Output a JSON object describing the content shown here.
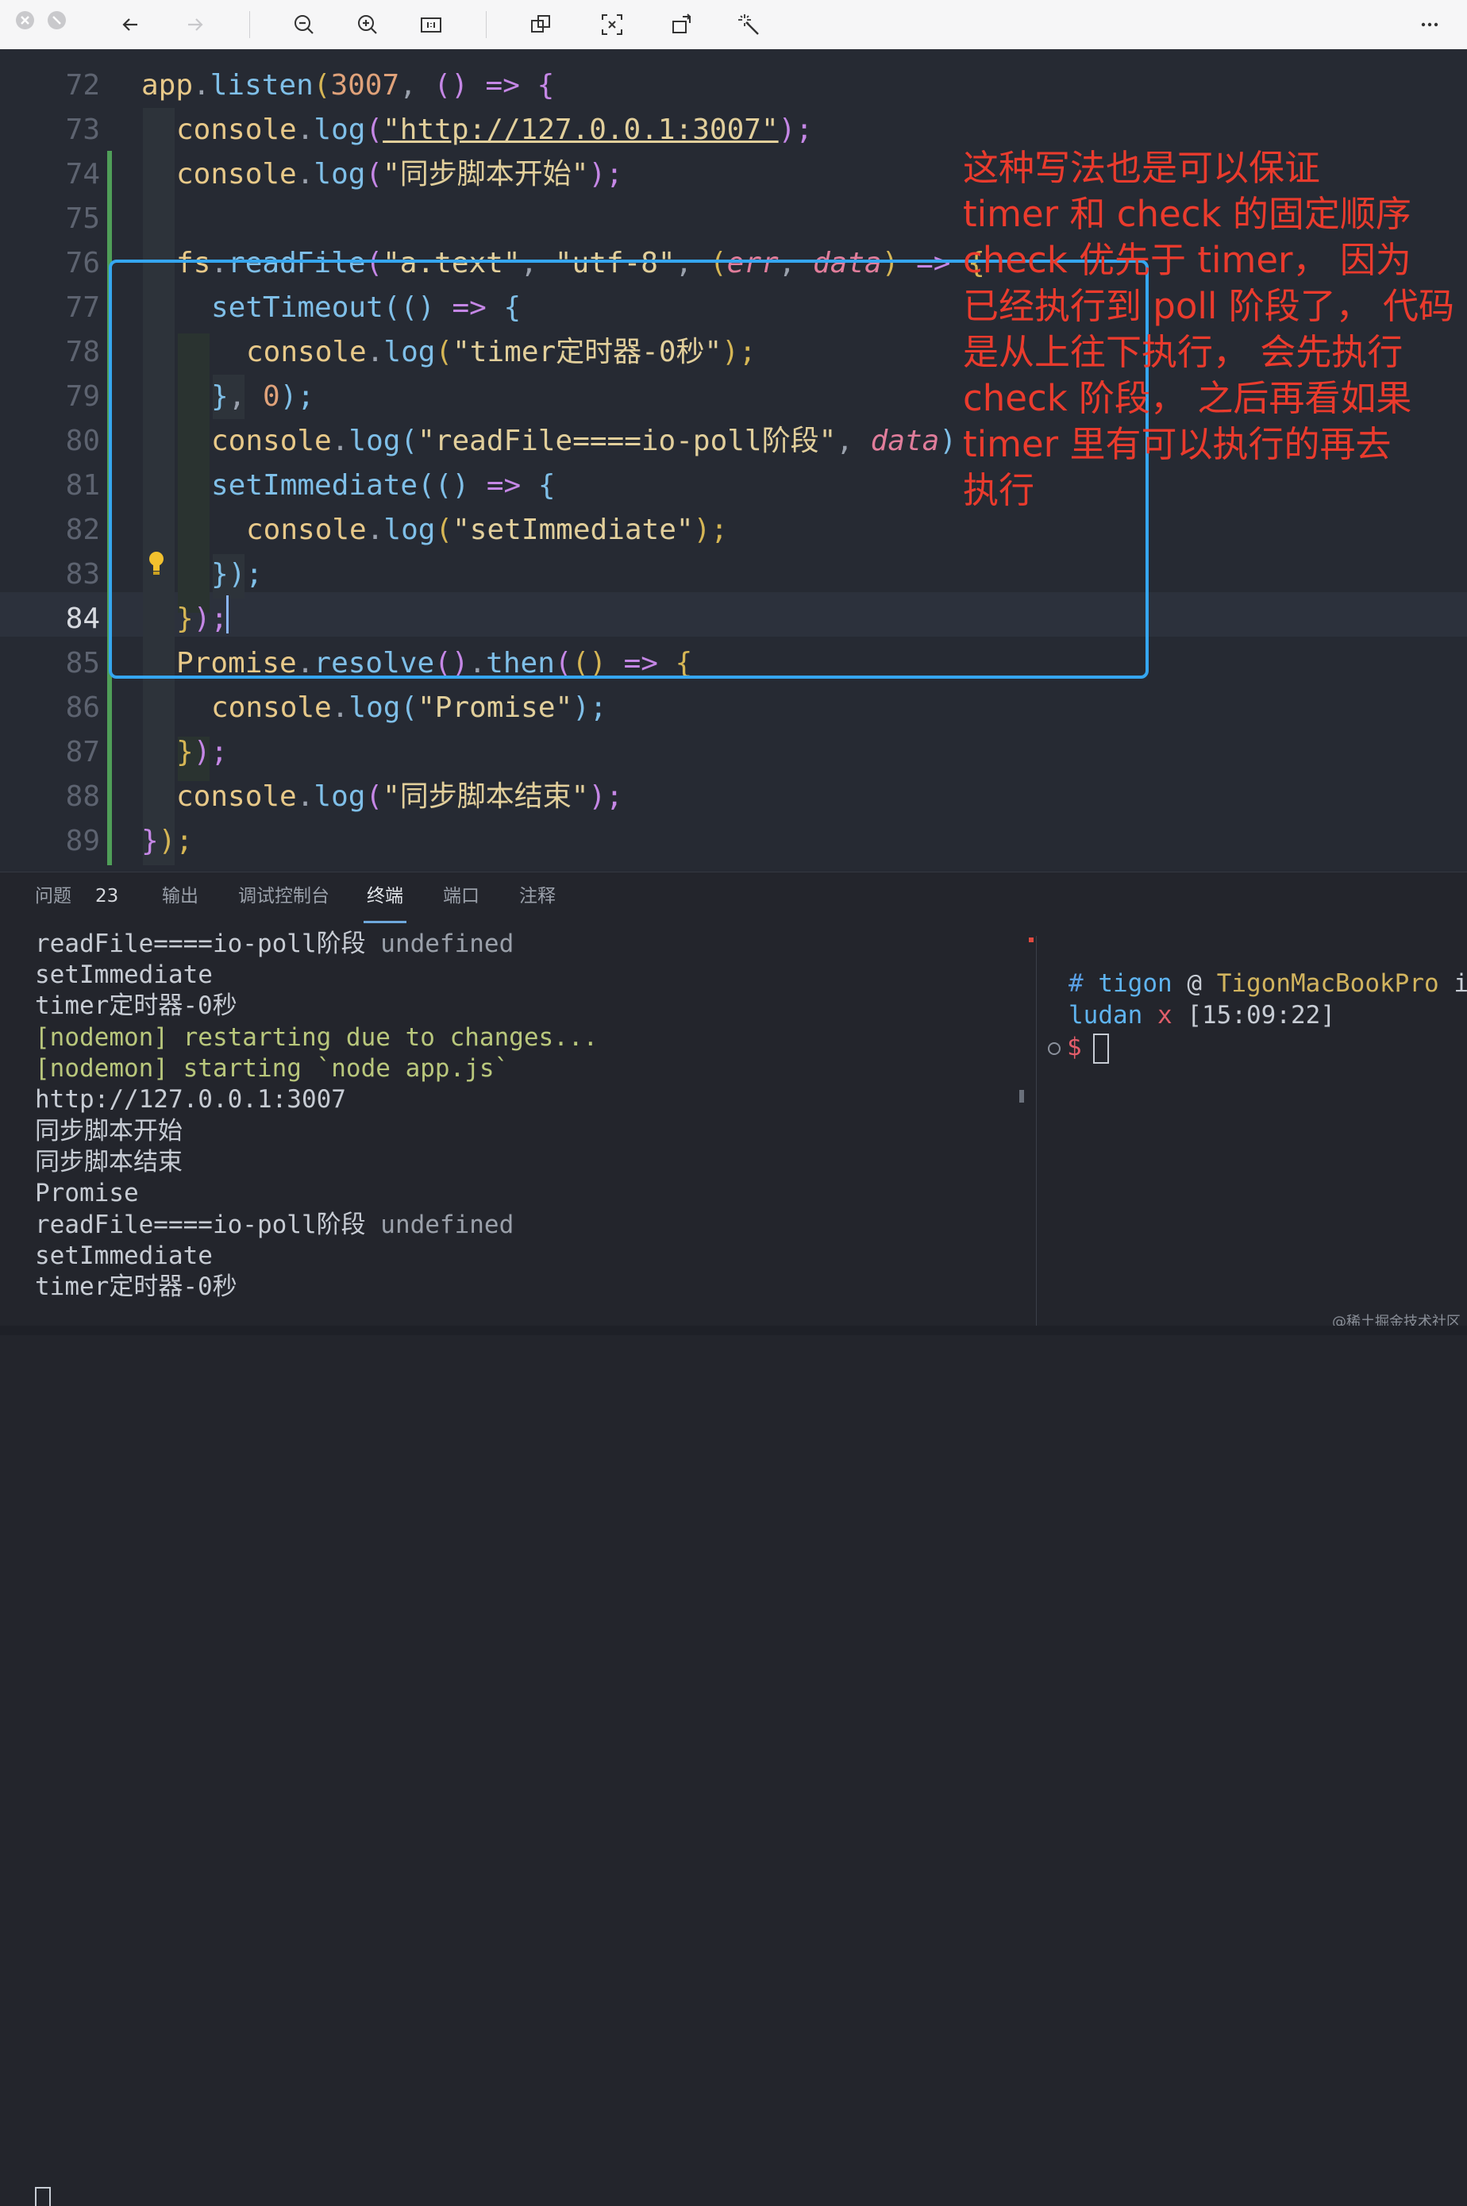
{
  "toolbar": {
    "buttons": [
      "close-icon",
      "minimize-icon",
      "back-icon",
      "forward-icon",
      "zoom-out-icon",
      "zoom-in-icon",
      "actual-size-icon",
      "translate-icon",
      "scan-text-icon",
      "rotate-icon",
      "magic-wand-icon",
      "more-icon"
    ]
  },
  "editor": {
    "line_numbers": [
      "72",
      "73",
      "74",
      "75",
      "76",
      "77",
      "78",
      "79",
      "80",
      "81",
      "82",
      "83",
      "84",
      "85",
      "86",
      "87",
      "88",
      "89"
    ],
    "active_line": "84",
    "code": {
      "l72": {
        "a": "app",
        "b": ".",
        "c": "listen",
        "d": "(",
        "e": "3007",
        "f": ", ",
        "g": "()",
        "h": " => ",
        "i": "{"
      },
      "l73": {
        "a": "console",
        "b": ".",
        "c": "log",
        "d": "(",
        "e": "\"http://127.0.0.1:3007\"",
        "f": ");"
      },
      "l74": {
        "a": "console",
        "b": ".",
        "c": "log",
        "d": "(",
        "e": "\"同步脚本开始\"",
        "f": ");"
      },
      "l76": {
        "a": "fs",
        "b": ".",
        "c": "readFile",
        "d": "(",
        "e": "\"a.text\"",
        "f": ", ",
        "g": "\"utf-8\"",
        "h": ", ",
        "i": "(",
        "j": "err",
        "k": ", ",
        "l": "data",
        "m": ")",
        "n": " => ",
        "o": "{"
      },
      "l77": {
        "a": "setTimeout",
        "b": "(",
        "c": "()",
        "d": " => ",
        "e": "{"
      },
      "l78": {
        "a": "console",
        "b": ".",
        "c": "log",
        "d": "(",
        "e": "\"timer定时器-0秒\"",
        "f": ");"
      },
      "l79": {
        "a": "}",
        "b": ", ",
        "c": "0",
        "d": ");"
      },
      "l80": {
        "a": "console",
        "b": ".",
        "c": "log",
        "d": "(",
        "e": "\"readFile====io-poll阶段\"",
        "f": ", ",
        "g": "data",
        "h": ")"
      },
      "l81": {
        "a": "setImmediate",
        "b": "(",
        "c": "()",
        "d": " => ",
        "e": "{"
      },
      "l82": {
        "a": "console",
        "b": ".",
        "c": "log",
        "d": "(",
        "e": "\"setImmediate\"",
        "f": ");"
      },
      "l83": {
        "a": "}",
        "b": ");"
      },
      "l84": {
        "a": "}",
        "b": ");"
      },
      "l85": {
        "a": "Promise",
        "b": ".",
        "c": "resolve",
        "d": "()",
        "e": ".",
        "f": "then",
        "g": "(",
        "h": "()",
        "i": " => ",
        "j": "{"
      },
      "l86": {
        "a": "console",
        "b": ".",
        "c": "log",
        "d": "(",
        "e": "\"Promise\"",
        "f": ");"
      },
      "l87": {
        "a": "}",
        "b": ");"
      },
      "l88": {
        "a": "console",
        "b": ".",
        "c": "log",
        "d": "(",
        "e": "\"同步脚本结束\"",
        "f": ");"
      },
      "l89": {
        "a": "}",
        "b": ");"
      }
    }
  },
  "annotation": {
    "lines": [
      "这种写法也是可以保证",
      "timer 和 check 的固定顺序",
      "check 优先于 timer， 因为",
      "已经执行到 poll 阶段了， 代码",
      "是从上往下执行， 会先执行",
      "check 阶段， 之后再看如果",
      "timer 里有可以执行的再去",
      "执行"
    ],
    "color": "#ea3b2d",
    "box_color": "#35a6f0"
  },
  "panel": {
    "tabs": [
      "问题",
      "输出",
      "调试控制台",
      "终端",
      "端口",
      "注释"
    ],
    "problems_count": "23",
    "active_tab": "终端"
  },
  "terminal_left": {
    "lines": [
      {
        "text": "readFile====io-poll阶段 ",
        "extra": "undefined"
      },
      {
        "text": "setImmediate",
        "extra": ""
      },
      {
        "text": "timer定时器-0秒",
        "extra": ""
      },
      {
        "text": "[nodemon] restarting due to changes...",
        "extra": ""
      },
      {
        "text": "[nodemon] starting `node app.js`",
        "extra": ""
      },
      {
        "text": "http://127.0.0.1:3007",
        "extra": ""
      },
      {
        "text": "同步脚本开始",
        "extra": ""
      },
      {
        "text": "同步脚本结束",
        "extra": ""
      },
      {
        "text": "Promise",
        "extra": ""
      },
      {
        "text": "readFile====io-poll阶段 ",
        "extra": "undefined"
      },
      {
        "text": "setImmediate",
        "extra": ""
      },
      {
        "text": "timer定时器-0秒",
        "extra": ""
      }
    ]
  },
  "terminal_right": {
    "hash": "#",
    "user": "tigon",
    "at": "@",
    "host": "TigonMacBookPro",
    "host_tail": "i",
    "dir": "ludan",
    "x": "x",
    "time": "[15:09:22]",
    "prompt": "$"
  },
  "watermark": "@稀土掘金技术社区"
}
